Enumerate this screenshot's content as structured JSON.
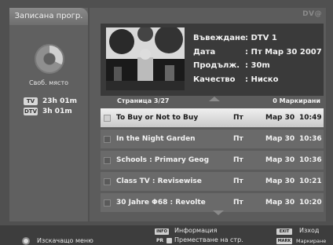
{
  "left": {
    "tab_label": "Записана прогр.",
    "free_space_label": "Своб. място",
    "recordings": [
      {
        "badge": "TV",
        "duration": "23h 01m"
      },
      {
        "badge": "DTV",
        "duration": "3h 01m"
      }
    ]
  },
  "brand": "DV@",
  "info": {
    "rows": [
      {
        "key": "Въвеждане",
        "value": ": DTV 1"
      },
      {
        "key": "Дата",
        "value": ": Пт Мар 30 2007"
      },
      {
        "key": "Продълж.",
        "value": ": 30m"
      },
      {
        "key": "Качество",
        "value": ": Ниско"
      }
    ]
  },
  "list": {
    "page": "Страница   3/27",
    "marks": "0 Маркирани",
    "items": [
      {
        "title": "To Buy or Not to Buy",
        "day": "Пт",
        "date": "Мар 30",
        "time": "10:49"
      },
      {
        "title": "In the Night Garden",
        "day": "Пт",
        "date": "Мар 30",
        "time": "10:36"
      },
      {
        "title": "Schools : Primary Geog",
        "day": "Пт",
        "date": "Мар 30",
        "time": "10:36"
      },
      {
        "title": "Class TV : Revisewise",
        "day": "Пт",
        "date": "Мар 30",
        "time": "10:21"
      },
      {
        "title": "30 Jahre Φ68 : Revolte",
        "day": "Пт",
        "date": "Мар 30",
        "time": "10:20"
      }
    ]
  },
  "bottom": {
    "exit_menu": "Изскачащо меню",
    "info_key": "INFO",
    "info_label": "Информация",
    "pr_key": "PR",
    "move_label": "Преместване на стр.",
    "exit_key": "EXIT",
    "exit_label": "Изход",
    "mark_key": "MARK",
    "mark_label": "Маркиране"
  },
  "colors": {
    "background": "#505050",
    "selected_row": "#e6e6e6",
    "row": "#6a6a6a"
  }
}
